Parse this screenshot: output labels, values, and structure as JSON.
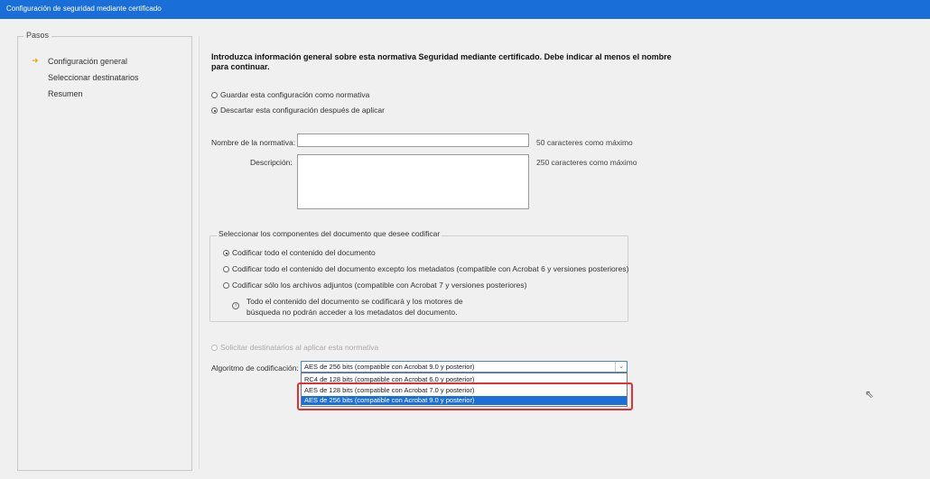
{
  "window": {
    "title": "Configuración de seguridad mediante certificado"
  },
  "steps": {
    "title": "Pasos",
    "items": [
      {
        "label": "Configuración general"
      },
      {
        "label": "Seleccionar destinatarios"
      },
      {
        "label": "Resumen"
      }
    ],
    "current_marker": "➜"
  },
  "main": {
    "intro": "Introduzca información general sobre esta normativa Seguridad mediante certificado. Debe indicar al menos el nombre para continuar.",
    "save_options": [
      {
        "label": "Guardar esta configuración como normativa",
        "checked": false
      },
      {
        "label": "Descartar esta configuración después de aplicar",
        "checked": true
      }
    ],
    "name_label": "Nombre de la normativa:",
    "name_value": "",
    "name_hint": "50 caracteres como máximo",
    "desc_label": "Descripción:",
    "desc_value": "",
    "desc_hint": "250 caracteres como máximo",
    "components": {
      "title": "Seleccionar los componentes del documento que desee codificar",
      "options": [
        {
          "label": "Codificar todo el contenido del documento",
          "checked": true
        },
        {
          "label": "Codificar todo el contenido del documento excepto los metadatos (compatible con Acrobat 6 y versiones posteriores)",
          "checked": false
        },
        {
          "label": "Codificar sólo los archivos adjuntos (compatible con Acrobat 7 y versiones posteriores)",
          "checked": false
        }
      ],
      "info_line1": "Todo el contenido del documento se codificará y los motores de",
      "info_line2": "búsqueda no podrán acceder a los metadatos del documento."
    },
    "ask_recipients": "Solicitar destinatarios al aplicar esta normativa",
    "algorithm": {
      "label": "Algoritmo de codificación:",
      "selected": "AES de 256 bits (compatible con Acrobat 9.0 y posterior)",
      "options": [
        "RC4 de 128 bits (compatible con Acrobat 6.0 y posterior)",
        "AES de 128 bits (compatible con Acrobat 7.0 y posterior)",
        "AES de 256 bits (compatible con Acrobat 9.0 y posterior)"
      ],
      "highlighted_index": 2
    }
  },
  "colors": {
    "titlebar": "#1a6ed8",
    "selection": "#1c6fd8",
    "highlight": "#e0303a"
  }
}
